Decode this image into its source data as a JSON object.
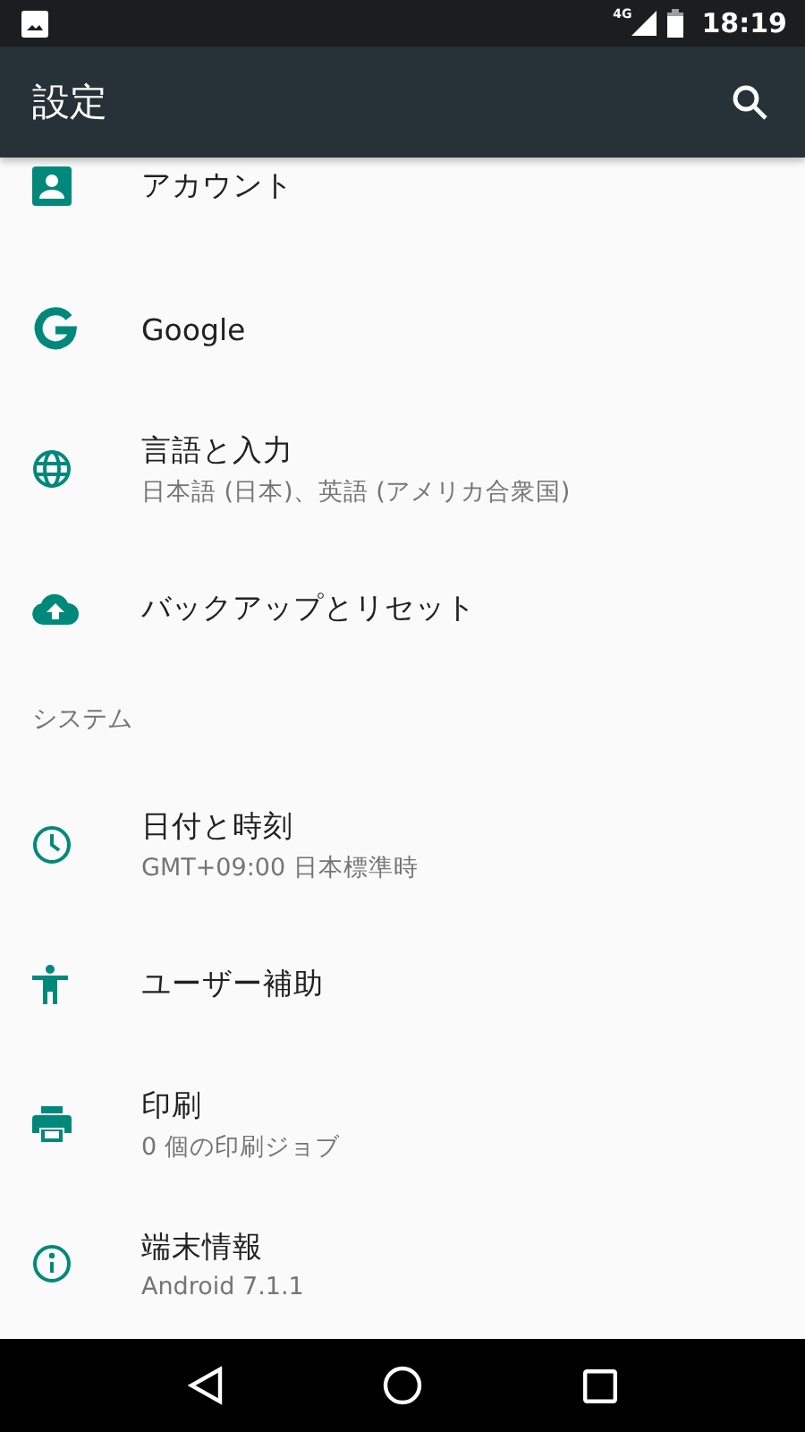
{
  "status_bar": {
    "network_type": "4G",
    "time": "18:19"
  },
  "app_bar": {
    "title": "設定"
  },
  "list": [
    {
      "kind": "item",
      "title": "アカウント",
      "partial": true
    },
    {
      "kind": "item",
      "title": "Google"
    },
    {
      "kind": "item",
      "title": "言語と入力",
      "summary": "日本語 (日本)、英語 (アメリカ合衆国)"
    },
    {
      "kind": "item",
      "title": "バックアップとリセット"
    },
    {
      "kind": "header",
      "title": "システム"
    },
    {
      "kind": "item",
      "title": "日付と時刻",
      "summary": "GMT+09:00 日本標準時"
    },
    {
      "kind": "item",
      "title": "ユーザー補助"
    },
    {
      "kind": "item",
      "title": "印刷",
      "summary": "0 個の印刷ジョブ"
    },
    {
      "kind": "item",
      "title": "端末情報",
      "summary": "Android 7.1.1"
    }
  ]
}
